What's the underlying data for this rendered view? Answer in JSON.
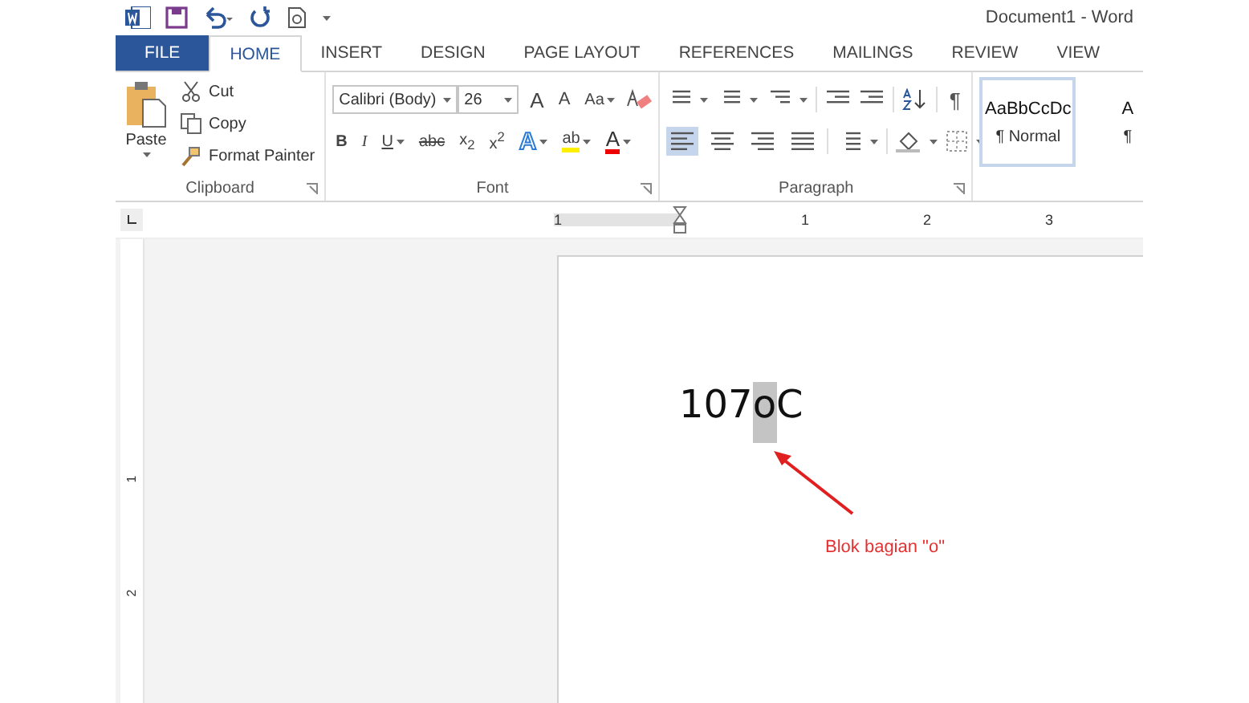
{
  "window": {
    "title": "Document1 - Word"
  },
  "tabs": [
    {
      "label": "FILE",
      "kind": "file",
      "selected": false
    },
    {
      "label": "HOME",
      "kind": "tab",
      "selected": true
    },
    {
      "label": "INSERT",
      "kind": "tab",
      "selected": false
    },
    {
      "label": "DESIGN",
      "kind": "tab",
      "selected": false
    },
    {
      "label": "PAGE LAYOUT",
      "kind": "tab",
      "selected": false
    },
    {
      "label": "REFERENCES",
      "kind": "tab",
      "selected": false
    },
    {
      "label": "MAILINGS",
      "kind": "tab",
      "selected": false
    },
    {
      "label": "REVIEW",
      "kind": "tab",
      "selected": false
    },
    {
      "label": "VIEW",
      "kind": "tab",
      "selected": false
    }
  ],
  "clipboard": {
    "label": "Clipboard",
    "paste": "Paste",
    "actions": [
      {
        "label": "Cut",
        "kind": "cut"
      },
      {
        "label": "Copy",
        "kind": "copy"
      },
      {
        "label": "Format Painter",
        "kind": "painter"
      }
    ]
  },
  "font": {
    "label": "Font",
    "name": "Calibri (Body)",
    "size": "26",
    "row1": [
      {
        "label": "A",
        "kind": "grow"
      },
      {
        "label": "A",
        "kind": "shrink"
      },
      {
        "label": "Aa",
        "kind": "case"
      }
    ],
    "row2": [
      {
        "label": "B",
        "kind": "bold"
      },
      {
        "label": "I",
        "kind": "italic"
      },
      {
        "label": "U",
        "kind": "underline"
      },
      {
        "label": "abc",
        "kind": "strike"
      },
      {
        "label": "x$_{2}$",
        "kind": "sub"
      },
      {
        "label": "x$^{2}$",
        "kind": "sup"
      },
      {
        "label": "A",
        "kind": "effects"
      },
      {
        "label": "ab",
        "kind": "highlight"
      },
      {
        "label": "A",
        "kind": "color"
      }
    ]
  },
  "paragraph": {
    "label": "Paragraph",
    "pilcrow": "¶",
    "alignment": [
      {
        "kind": "left",
        "selected": true
      },
      {
        "kind": "center",
        "selected": false
      },
      {
        "kind": "right",
        "selected": false
      },
      {
        "kind": "justify",
        "selected": false
      }
    ]
  },
  "styles": [
    {
      "sample": "AaBbCcDc",
      "name": "¶ Normal",
      "selected": true
    },
    {
      "sample": "A",
      "name": "¶",
      "selected": false
    }
  ],
  "ruler": {
    "marks": [
      "1",
      "1",
      "2",
      "3"
    ]
  },
  "vertical_ruler": {
    "marks": [
      "1",
      "2"
    ]
  },
  "document": {
    "segments": [
      {
        "text": "107",
        "selected": false
      },
      {
        "text": "o",
        "selected": true
      },
      {
        "text": "C",
        "selected": false
      }
    ]
  },
  "annotation": {
    "text": "Blok bagian \"o\""
  }
}
